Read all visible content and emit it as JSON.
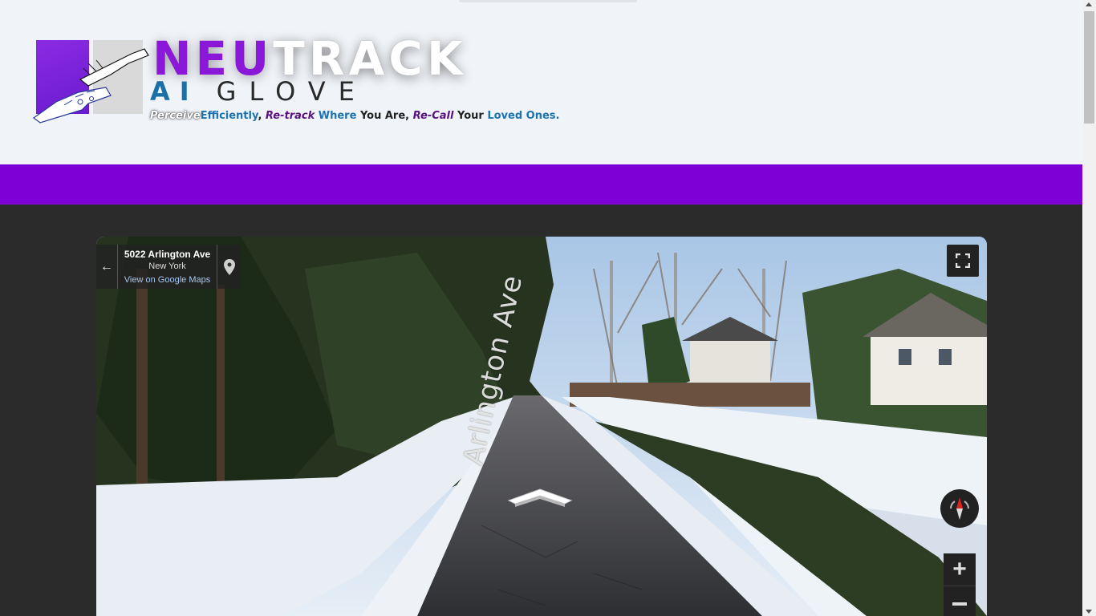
{
  "logo": {
    "title_part1": "NEU",
    "title_part2": "TRACK",
    "subtitle_part1": "AI",
    "subtitle_part2": "GLOVE",
    "tagline": {
      "perceive": "Perceive",
      "efficiently": "Efficiently",
      "comma1": ", ",
      "retrack": "Re-track",
      "where": " Where ",
      "you_are": "You Are",
      "comma2": ", ",
      "recall": "Re-Call",
      "your": " Your ",
      "loved_ones": "Loved Ones."
    }
  },
  "colors": {
    "brand_purple": "#7e00d6",
    "brand_blue": "#1d73b0",
    "header_bg": "#f0f3f8",
    "content_bg": "#2b2b2b"
  },
  "street_view": {
    "address_line": "5022 Arlington Ave",
    "city": "New York",
    "maps_link": "View on Google Maps",
    "street_label": "Arlington Ave",
    "icons": {
      "back": "back-arrow-icon",
      "pin": "map-pin-icon",
      "fullscreen": "fullscreen-icon",
      "compass": "compass-icon",
      "zoom_in": "plus-icon",
      "zoom_out": "minus-icon",
      "navigate": "chevron-up-icon"
    }
  }
}
